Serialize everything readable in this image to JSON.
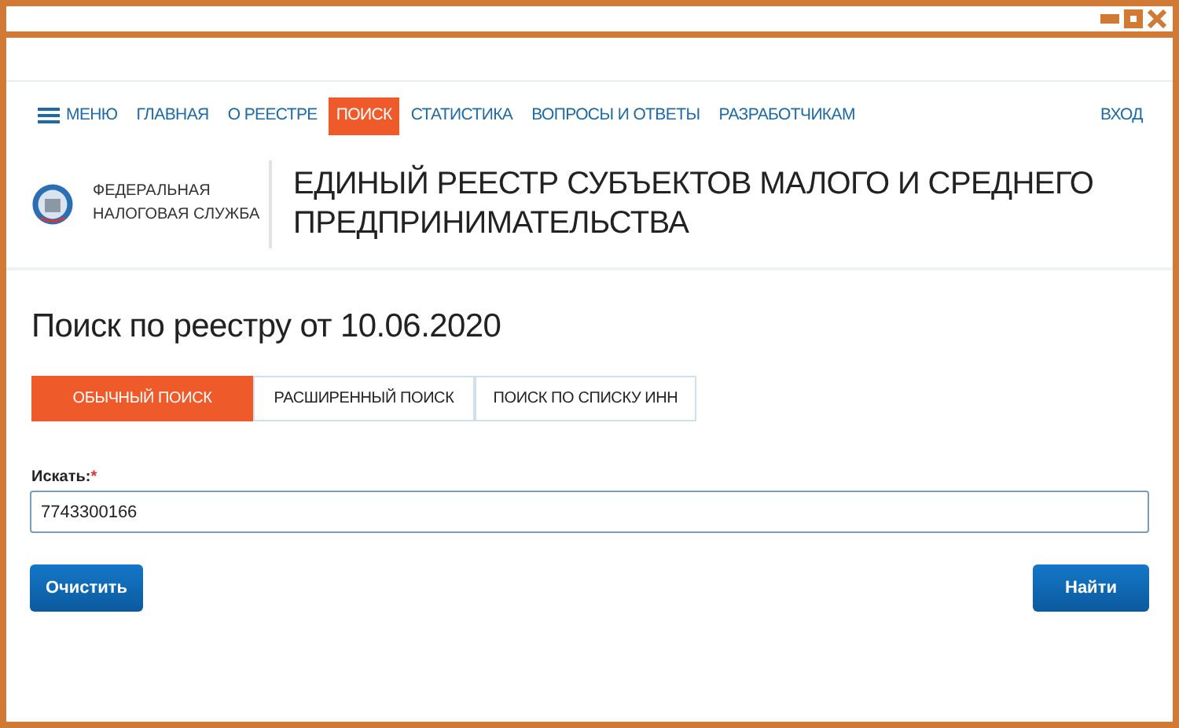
{
  "nav": {
    "menu": "МЕНЮ",
    "items": [
      {
        "label": "ГЛАВНАЯ",
        "selected": false
      },
      {
        "label": "О РЕЕСТРЕ",
        "selected": false
      },
      {
        "label": "ПОИСК",
        "selected": true
      },
      {
        "label": "СТАТИСТИКА",
        "selected": false
      },
      {
        "label": "ВОПРОСЫ И ОТВЕТЫ",
        "selected": false
      },
      {
        "label": "РАЗРАБОТЧИКАМ",
        "selected": false
      }
    ],
    "login": "ВХОД"
  },
  "header": {
    "org": [
      "ФЕДЕРАЛЬНАЯ",
      "НАЛОГОВАЯ СЛУЖБА"
    ],
    "title": "ЕДИНЫЙ РЕЕСТР СУБЪЕКТОВ МАЛОГО И СРЕДНЕГО ПРЕДПРИНИМАТЕЛЬСТВА"
  },
  "page_title": "Поиск по реестру от 10.06.2020",
  "tabs": [
    {
      "label": "ОБЫЧНЫЙ ПОИСК",
      "selected": true
    },
    {
      "label": "РАСШИРЕННЫЙ ПОИСК",
      "selected": false
    },
    {
      "label": "ПОИСК ПО СПИСКУ ИНН",
      "selected": false
    }
  ],
  "search": {
    "label": "Искать:",
    "required_mark": "*",
    "value": "7743300166"
  },
  "buttons": [
    {
      "label": "Очистить",
      "kind": "clear"
    },
    {
      "label": "Найти",
      "kind": "submit"
    }
  ]
}
